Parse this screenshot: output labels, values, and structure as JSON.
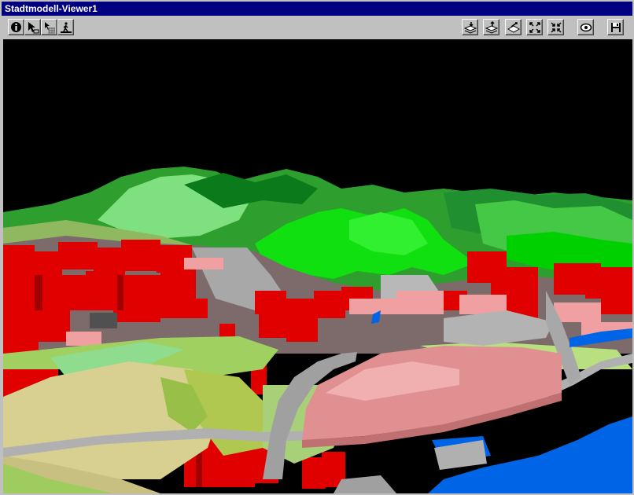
{
  "window": {
    "title": "Stadtmodell-Viewer1"
  },
  "toolbar": {
    "left_buttons": [
      {
        "icon": "info-icon"
      },
      {
        "icon": "select-pointer-icon"
      },
      {
        "icon": "pan-grid-icon"
      },
      {
        "icon": "walk-figure-icon"
      }
    ],
    "right_buttons": [
      {
        "icon": "layers-down-icon"
      },
      {
        "icon": "layers-up-icon"
      },
      {
        "icon": "rotate-view-icon"
      },
      {
        "icon": "zoom-in-icon"
      },
      {
        "icon": "zoom-out-icon"
      },
      {
        "icon": "orbit-eye-icon"
      },
      {
        "icon": "save-icon"
      }
    ]
  },
  "scene": {
    "colors": {
      "sky": "#000000",
      "forest_dark": "#008000",
      "forest_light": "#00e000",
      "buildings": "#e00000",
      "buildings_light": "#f0a0a0",
      "meadow": "#a0d060",
      "field": "#d8d090",
      "roads": "#b0b0b0",
      "water": "#0060e0"
    }
  }
}
